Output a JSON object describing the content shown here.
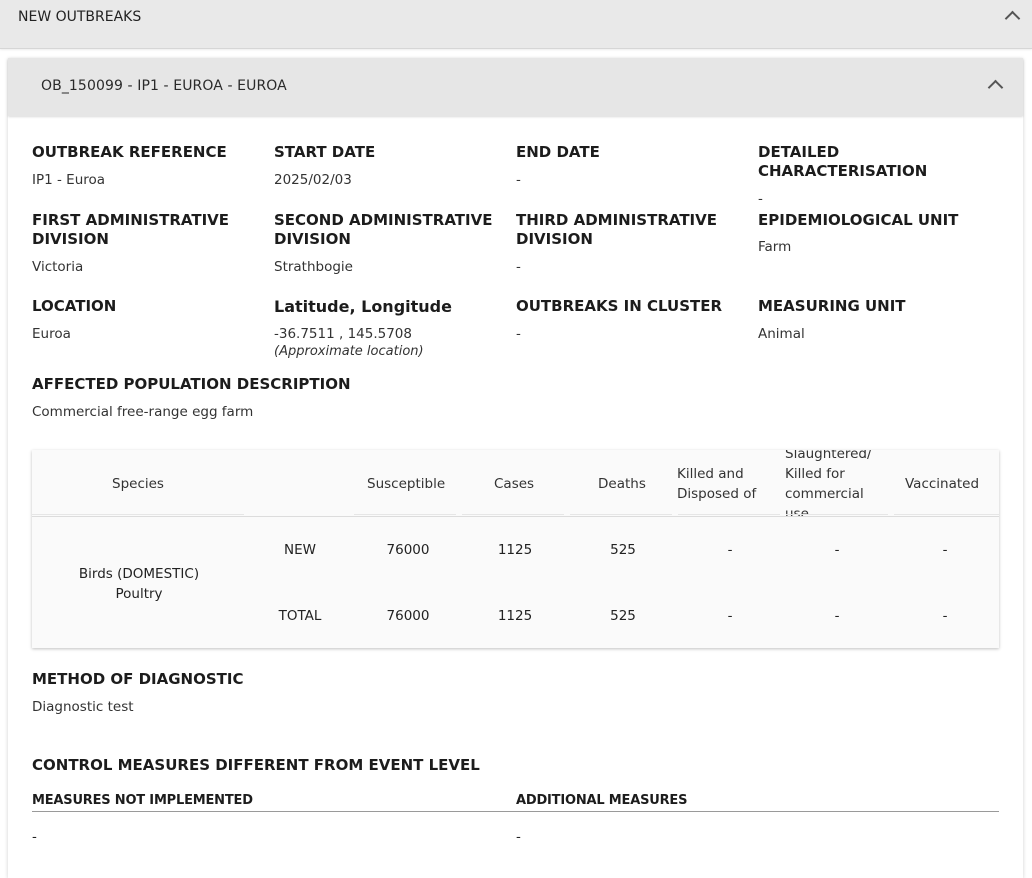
{
  "top": {
    "title": "NEW OUTBREAKS"
  },
  "card": {
    "title": "OB_150099 - IP1 - EUROA - EUROA"
  },
  "fields": {
    "outbreak_reference": {
      "label": "OUTBREAK REFERENCE",
      "value": "IP1 - Euroa"
    },
    "start_date": {
      "label": "START DATE",
      "value": "2025/02/03"
    },
    "end_date": {
      "label": "END DATE",
      "value": "-"
    },
    "detailed_characterisation": {
      "label": "DETAILED CHARACTERISATION",
      "value": "-"
    },
    "first_admin": {
      "label": "FIRST ADMINISTRATIVE DIVISION",
      "value": "Victoria"
    },
    "second_admin": {
      "label": "SECOND ADMINISTRATIVE DIVISION",
      "value": "Strathbogie"
    },
    "third_admin": {
      "label": "THIRD ADMINISTRATIVE DIVISION",
      "value": "-"
    },
    "epi_unit": {
      "label": "EPIDEMIOLOGICAL UNIT",
      "value": "Farm"
    },
    "location": {
      "label": "LOCATION",
      "value": "Euroa"
    },
    "lat_long": {
      "label": "Latitude, Longitude",
      "value": "-36.7511 , 145.5708",
      "note": "(Approximate location)"
    },
    "outbreaks_in_cluster": {
      "label": "OUTBREAKS IN CLUSTER",
      "value": "-"
    },
    "measuring_unit": {
      "label": "MEASURING UNIT",
      "value": "Animal"
    },
    "affected_population": {
      "label": "AFFECTED POPULATION DESCRIPTION",
      "value": "Commercial free-range egg farm"
    },
    "method_diagnostic": {
      "label": "METHOD OF DIAGNOSTIC",
      "value": "Diagnostic test"
    }
  },
  "table": {
    "headers": {
      "species": "Species",
      "susceptible": "Susceptible",
      "cases": "Cases",
      "deaths": "Deaths",
      "killed_line1": "Killed and",
      "killed_line2": "Disposed of",
      "slaughtered_line1": "Slaughtered/",
      "slaughtered_line2": "Killed for",
      "slaughtered_line3": "commercial",
      "slaughtered_line4": "use",
      "vaccinated": "Vaccinated"
    },
    "species_line1": "Birds (DOMESTIC)",
    "species_line2": "Poultry",
    "rows": [
      {
        "type": "NEW",
        "susceptible": "76000",
        "cases": "1125",
        "deaths": "525",
        "killed": "-",
        "slaughtered": "-",
        "vaccinated": "-"
      },
      {
        "type": "TOTAL",
        "susceptible": "76000",
        "cases": "1125",
        "deaths": "525",
        "killed": "-",
        "slaughtered": "-",
        "vaccinated": "-"
      }
    ]
  },
  "control": {
    "title": "CONTROL MEASURES DIFFERENT FROM EVENT LEVEL",
    "not_implemented_label": "MEASURES NOT IMPLEMENTED",
    "not_implemented_value": "-",
    "additional_label": "ADDITIONAL MEASURES",
    "additional_value": "-"
  }
}
